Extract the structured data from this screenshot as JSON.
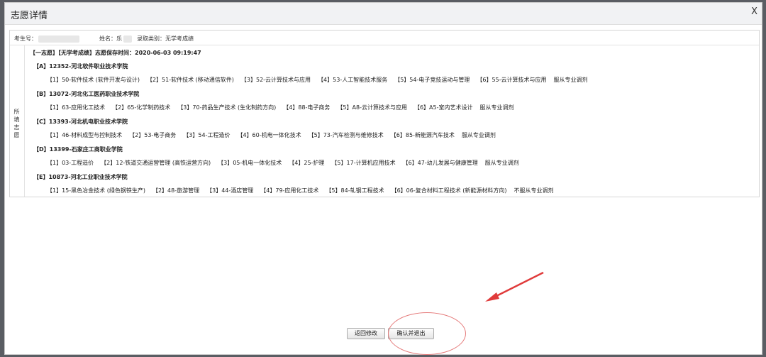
{
  "dialog": {
    "title": "志愿详情",
    "close": "X"
  },
  "info": {
    "exam_no_label": "考生号：",
    "name_label": "姓名：",
    "name_partial": "乐",
    "category": "录取类别：无学考成绩"
  },
  "section_label": "所填志愿",
  "header": "【一志愿】【无学考成绩】志愿保存时间：2020-06-03 09:19:47",
  "schools": [
    {
      "name": "【A】12352-河北软件职业技术学院",
      "majors": [
        "【1】50-软件技术 (软件开发与设计)",
        "【2】51-软件技术 (移动通信软件)",
        "【3】52-云计算技术与应用",
        "【4】53-人工智能技术服务",
        "【5】54-电子竞技运动与管理",
        "【6】55-云计算技术与应用",
        "服从专业调剂"
      ]
    },
    {
      "name": "【B】13072-河北化工医药职业技术学院",
      "majors": [
        "【1】63-应用化工技术",
        "【2】65-化学制药技术",
        "【3】70-药品生产技术 (生化制药方向)",
        "【4】88-电子商务",
        "【5】A8-云计算技术与应用",
        "【6】A5-室内艺术设计",
        "服从专业调剂"
      ]
    },
    {
      "name": "【C】13393-河北机电职业技术学院",
      "majors": [
        "【1】46-材料成型与控制技术",
        "【2】53-电子商务",
        "【3】54-工程造价",
        "【4】60-机电一体化技术",
        "【5】73-汽车检测与维修技术",
        "【6】85-新能源汽车技术",
        "服从专业调剂"
      ]
    },
    {
      "name": "【D】13399-石家庄工商职业学院",
      "majors": [
        "【1】03-工程造价",
        "【2】12-铁道交通运营管理 (高铁运营方向)",
        "【3】05-机电一体化技术",
        "【4】25-护理",
        "【5】17-计算机应用技术",
        "【6】47-幼儿发展与健康管理",
        "服从专业调剂"
      ]
    },
    {
      "name": "【E】10873-河北工业职业技术学院",
      "majors": [
        "【1】15-黑色冶金技术 (绿色钢铁生产)",
        "【2】48-旅游管理",
        "【3】44-酒店管理",
        "【4】79-应用化工技术",
        "【5】84-轧钢工程技术",
        "【6】06-复合材料工程技术 (新能源材料方向)",
        "不服从专业调剂"
      ]
    }
  ],
  "buttons": {
    "back": "返回修改",
    "confirm": "确认并退出"
  },
  "colors": {
    "annotation": "#e03b3b",
    "overlay": "#5a5d63"
  }
}
